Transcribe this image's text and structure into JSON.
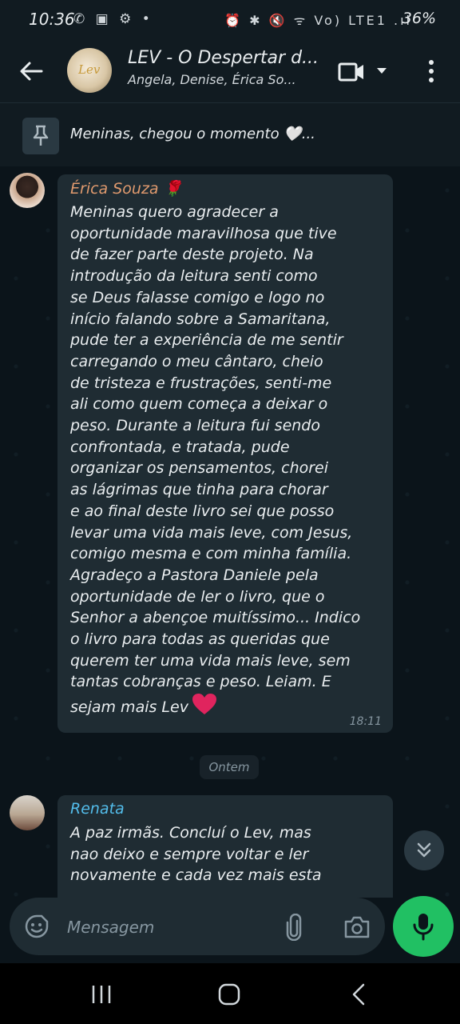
{
  "status_bar": {
    "time": "10:36",
    "left_icons": "✆ ▣ ⚙ •",
    "right_icons": "⏰ ✱ 🔇 ᯤ Vo) LTE1 .ıl",
    "battery": "36%"
  },
  "header": {
    "avatar_text": "Lev",
    "title": "LEV - O Despertar d...",
    "subtitle": "Angela, Denise, Érica So..."
  },
  "pinned": {
    "text": "Meninas, chegou o momento 🤍..."
  },
  "messages": [
    {
      "sender": "Érica Souza 🌹",
      "lines": [
        "Meninas quero agradecer a",
        "oportunidade  maravilhosa que tive",
        "de fazer parte deste projeto. Na",
        "introdução da leitura senti como",
        "se Deus falasse comigo e logo no",
        "início falando sobre a Samaritana,",
        "pude ter a experiência de me  sentir",
        "carregando o meu cântaro, cheio",
        "de tristeza e frustrações, senti-me",
        "ali como quem começa a deixar o",
        "peso. Durante a leitura fui sendo",
        "confrontada, e tratada, pude",
        "organizar os pensamentos, chorei",
        "as lágrimas que tinha para chorar",
        "e ao final deste livro sei que posso",
        "levar uma vida mais leve, com Jesus,",
        "comigo mesma e com minha família.",
        "Agradeço a Pastora Daniele pela",
        "oportunidade de ler o livro, que o",
        "Senhor a abençoe muitíssimo... Indico",
        "o livro para todas as queridas que",
        "querem ter uma vida mais leve, sem",
        "tantas cobranças e peso. Leiam. E",
        "sejam mais Lev"
      ],
      "time": "18:11"
    },
    {
      "sender": "Renata",
      "lines": [
        "A paz irmãs. Concluí o Lev, mas",
        "nao deixo e sempre voltar e ler",
        "novamente e cada vez mais esta"
      ]
    }
  ],
  "day_divider": "Ontem",
  "composer": {
    "placeholder": "Mensagem"
  },
  "colors": {
    "background": "#0b141a",
    "bubble": "#1f2c33",
    "accent_green": "#21c063",
    "sender_erica": "#e09a6e",
    "sender_renata": "#53bdeb",
    "heart": "#e0245e"
  }
}
